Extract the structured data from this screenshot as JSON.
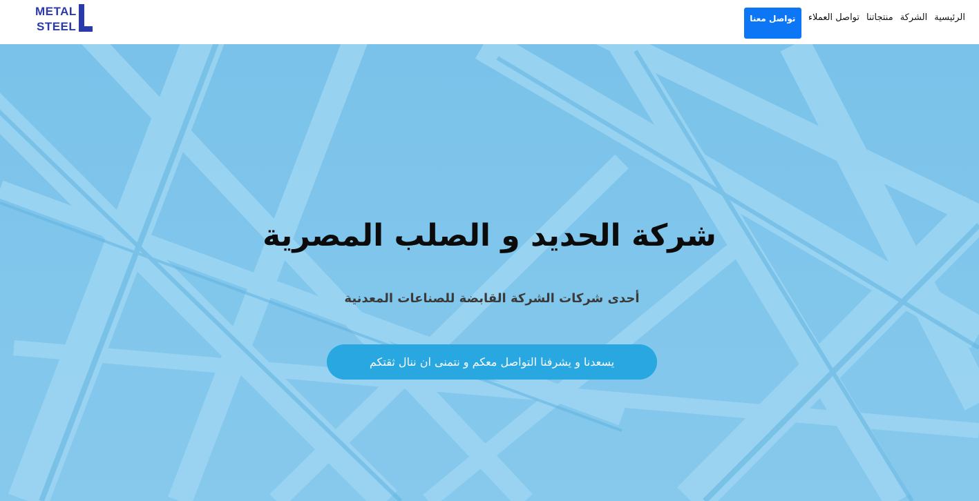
{
  "header": {
    "logo_text": [
      "METAL",
      "STEEL"
    ],
    "brand_color": "#2a3aa8",
    "nav": [
      {
        "label": "الرئيسية"
      },
      {
        "label": "الشركة"
      },
      {
        "label": "منتجاتنا"
      },
      {
        "label": "تواصل العملاء"
      }
    ],
    "cta_label": "تواصل معنا",
    "cta_color": "#0d76f5"
  },
  "hero": {
    "title": "شركة الحديد و الصلب المصرية",
    "subtitle": "أحدى شركات الشركة القابضة للصناعات المعدنية",
    "button_label": "يسعدنا و يشرفنا التواصل معكم و نتمنى ان ننال ثقتكم",
    "button_color": "#29a7e1",
    "background_color": "#80c6ea"
  }
}
